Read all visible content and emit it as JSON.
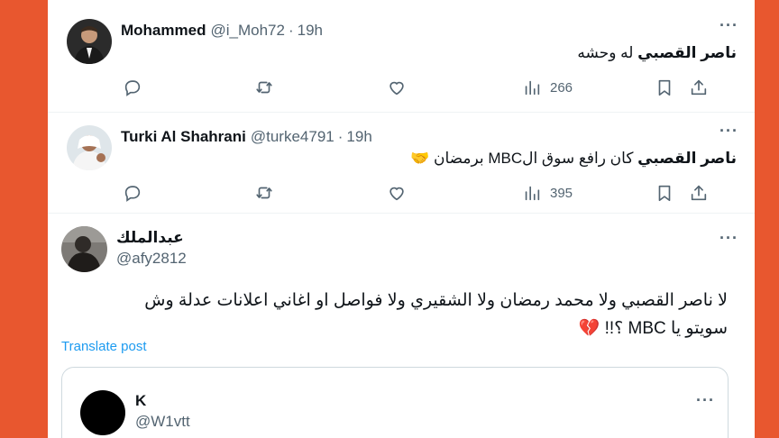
{
  "tweets": [
    {
      "name": "Mohammed",
      "handle": "@i_Moh72",
      "dot": "·",
      "time": "19h",
      "text_bold": "ناصر القصبي",
      "text_rest": "له وحشه",
      "views": "266"
    },
    {
      "name": "Turki Al Shahrani",
      "handle": "@turke4791",
      "dot": "·",
      "time": "19h",
      "text_bold": "ناصر القصبي",
      "text_rest": "كان رافع سوق الMBC برمضان",
      "emoji": "🤝",
      "views": "395"
    }
  ],
  "main_tweet": {
    "name": "عبدالملك",
    "handle": "@afy2812",
    "line1": "لا ناصر القصبي ولا محمد رمضان ولا الشقيري ولا فواصل او اغاني اعلانات عدلة وش",
    "line2": "سويتو يا MBC ؟!!",
    "emoji": "💔",
    "translate": "Translate post"
  },
  "quoted": {
    "name": "K",
    "handle": "@W1vtt"
  },
  "more_glyph": "···",
  "colors": {
    "background": "#e8572f",
    "card": "#ffffff",
    "text": "#0f1419",
    "secondary": "#536471",
    "link": "#1d9bf0"
  },
  "icons": [
    "reply-icon",
    "retweet-icon",
    "like-icon",
    "views-icon",
    "bookmark-icon",
    "share-icon",
    "more-icon"
  ]
}
